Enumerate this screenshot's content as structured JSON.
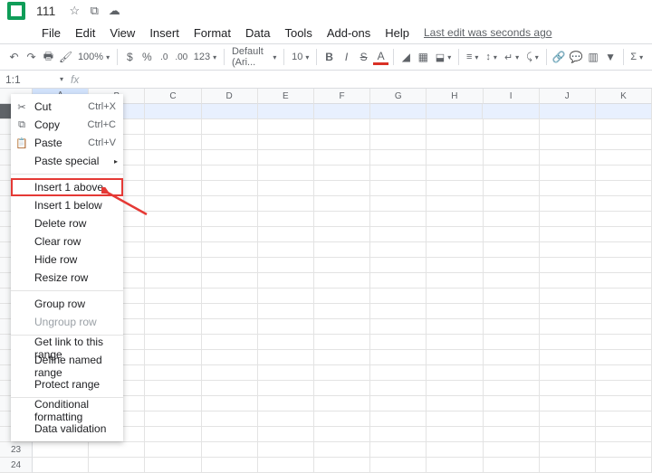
{
  "doc_title": "111",
  "menubar": [
    "File",
    "Edit",
    "View",
    "Insert",
    "Format",
    "Data",
    "Tools",
    "Add-ons",
    "Help"
  ],
  "last_edit": "Last edit was seconds ago",
  "toolbar": {
    "zoom": "100%",
    "currency": "$",
    "percent": "%",
    "dec_dec": ".0",
    "inc_dec": ".00",
    "more_formats": "123",
    "font": "Default (Ari...",
    "font_size": "10",
    "bold": "B",
    "italic": "I",
    "strike": "S",
    "textcolor": "A"
  },
  "namebox": "1:1",
  "fx": "fx",
  "columns": [
    "A",
    "B",
    "C",
    "D",
    "E",
    "F",
    "G",
    "H",
    "I",
    "J",
    "K"
  ],
  "row_count": 24,
  "context_menu": {
    "cut": {
      "label": "Cut",
      "shortcut": "Ctrl+X"
    },
    "copy": {
      "label": "Copy",
      "shortcut": "Ctrl+C"
    },
    "paste": {
      "label": "Paste",
      "shortcut": "Ctrl+V"
    },
    "paste_special": "Paste special",
    "insert_above": "Insert 1 above",
    "insert_below": "Insert 1 below",
    "delete_row": "Delete row",
    "clear_row": "Clear row",
    "hide_row": "Hide row",
    "resize_row": "Resize row",
    "group_row": "Group row",
    "ungroup_row": "Ungroup row",
    "get_link": "Get link to this range",
    "named_range": "Define named range",
    "protect": "Protect range",
    "cond_format": "Conditional formatting",
    "data_valid": "Data validation"
  }
}
